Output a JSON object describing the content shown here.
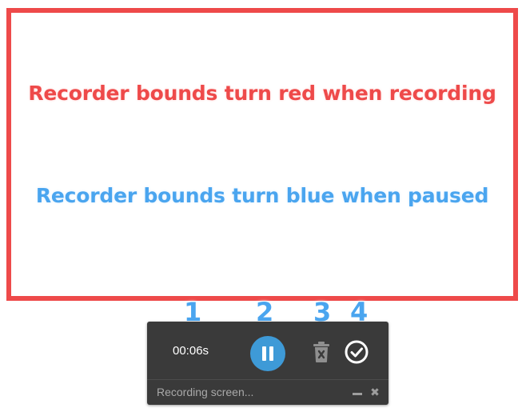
{
  "bounds": {
    "color": "#ee4a4a"
  },
  "captions": {
    "recording": "Recorder bounds turn red when recording",
    "paused": "Recorder bounds turn blue when paused",
    "recording_color": "#ee4a4a",
    "paused_color": "#4aa5ef"
  },
  "callouts": [
    "1",
    "2",
    "3",
    "4"
  ],
  "toolbar": {
    "timer": "00:06s",
    "pause_icon": "pause-icon",
    "discard_icon": "trash-icon",
    "done_icon": "check-circle-icon",
    "accent_color": "#3e9ad7",
    "background_color": "#3a3a3a"
  },
  "status_bar": {
    "text": "Recording screen...",
    "minimize_icon": "minimize-icon",
    "close_icon": "close-icon",
    "close_glyph": "✖"
  }
}
